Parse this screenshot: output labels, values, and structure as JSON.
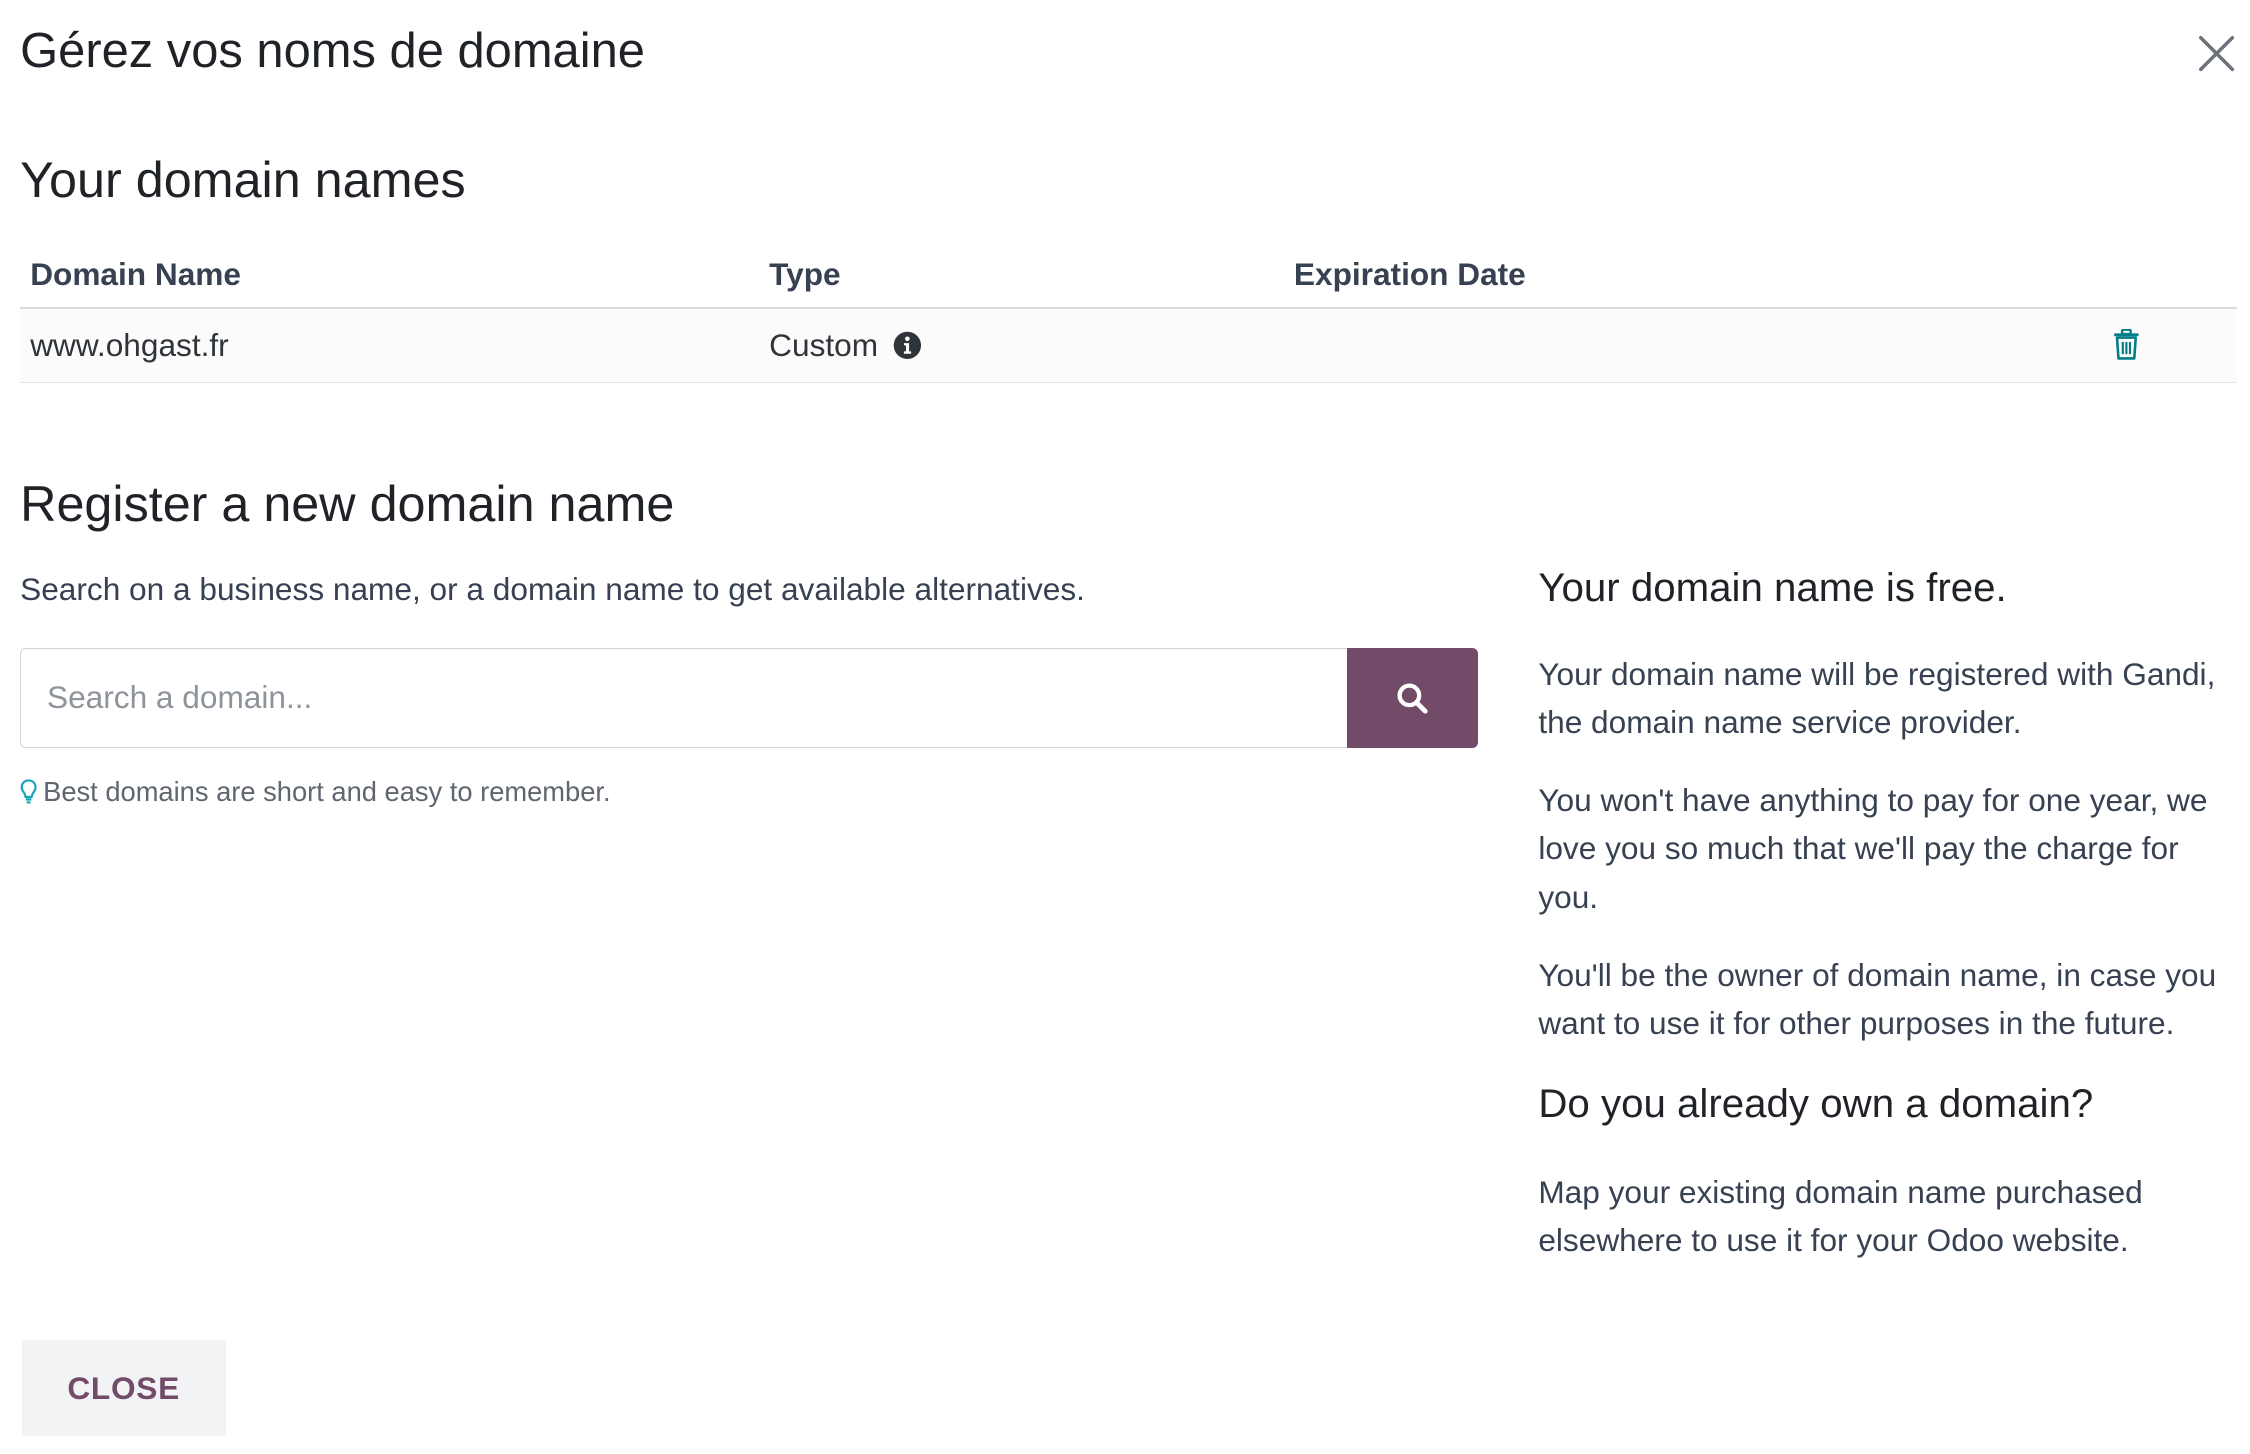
{
  "modal": {
    "title": "Gérez vos noms de domaine",
    "close_icon": "close-icon",
    "close_button_label": "CLOSE"
  },
  "domains": {
    "title": "Your domain names",
    "columns": [
      "Domain Name",
      "Type",
      "Expiration Date"
    ],
    "rows": [
      {
        "domain": "www.ohgast.fr",
        "type": "Custom",
        "expiration": ""
      }
    ]
  },
  "register": {
    "title": "Register a new domain name",
    "hint": "Search on a business name, or a domain name to get available alternatives.",
    "search_placeholder": "Search a domain...",
    "tip": "Best domains are short and easy to remember."
  },
  "info": {
    "free_title": "Your domain name is free.",
    "p1": "Your domain name will be registered with Gandi, the domain name service provider.",
    "p2": "You won't have anything to pay for one year, we love you so much that we'll pay the charge for you.",
    "p3": "You'll be the owner of domain name, in case you want to use it for other purposes in the future.",
    "own_title": "Do you already own a domain?",
    "p4": "Map your existing domain name purchased elsewhere to use it for your Odoo website."
  },
  "colors": {
    "brand": "#714b67",
    "trash": "#017e84",
    "tip_bulb": "#17a2b8"
  }
}
